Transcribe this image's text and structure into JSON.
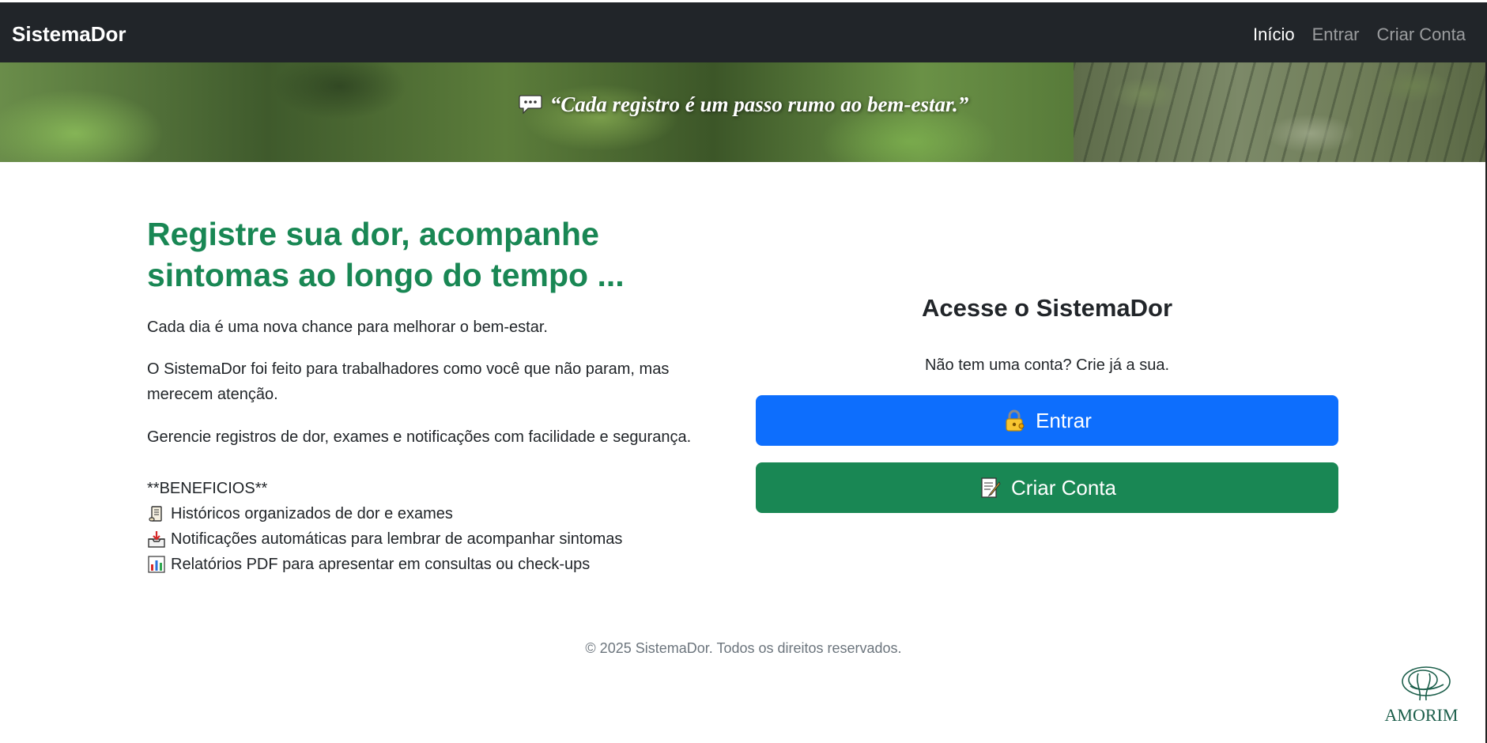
{
  "app": {
    "brand": "SistemaDor"
  },
  "nav": {
    "items": [
      {
        "label": "Início",
        "active": true
      },
      {
        "label": "Entrar",
        "active": false
      },
      {
        "label": "Criar Conta",
        "active": false
      }
    ]
  },
  "banner": {
    "quote": "“Cada registro é um passo rumo ao bem-estar.”",
    "icon": "speech-bubble-icon"
  },
  "hero": {
    "headline_line1": "Registre sua dor, acompanhe",
    "headline_line2": "sintomas ao longo do tempo ...",
    "p1": "Cada dia é uma nova chance para melhorar o bem-estar.",
    "p2": "O SistemaDor foi feito para trabalhadores como você que não param, mas merecem atenção.",
    "p3": "Gerencie registros de dor, exames e notificações com facilidade e segurança.",
    "benefits_title": "**BENEFICIOS**",
    "benefits": [
      {
        "icon": "scroll-icon",
        "text": "Históricos organizados de dor e exames"
      },
      {
        "icon": "inbox-tray-icon",
        "text": "Notificações automáticas para lembrar de acompanhar sintomas"
      },
      {
        "icon": "bar-chart-icon",
        "text": "Relatórios PDF para apresentar em consultas ou check-ups"
      }
    ]
  },
  "access": {
    "title": "Acesse o SistemaDor",
    "subtitle": "Não tem uma conta? Crie já a sua.",
    "login_label": "Entrar",
    "login_icon": "lock-key-icon",
    "signup_label": "Criar Conta",
    "signup_icon": "memo-icon"
  },
  "footer": {
    "text": "© 2025 SistemaDor. Todos os direitos reservados."
  },
  "logo": {
    "text": "AMORIM"
  },
  "colors": {
    "navbar": "#212529",
    "headline": "#198754",
    "primary": "#0d6efd",
    "success": "#198754",
    "muted": "#6c757d"
  }
}
